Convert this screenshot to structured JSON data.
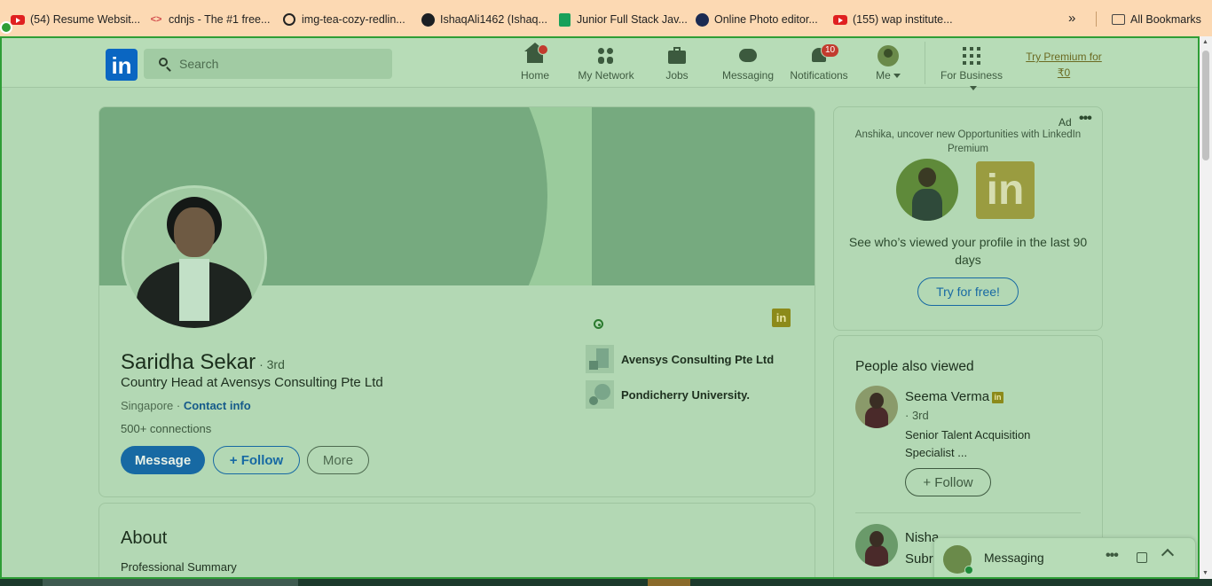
{
  "bookmarks": [
    {
      "label": "(54) Resume Websit...",
      "icon": "youtube-icon"
    },
    {
      "label": "cdnjs - The #1 free...",
      "icon": "code-icon"
    },
    {
      "label": "img-tea-cozy-redlin...",
      "icon": "globe-icon"
    },
    {
      "label": "IshaqAli1462 (Ishaq...",
      "icon": "github-icon"
    },
    {
      "label": "Junior Full Stack Jav...",
      "icon": "sheets-icon"
    },
    {
      "label": "Online Photo editor...",
      "icon": "photo-editor-icon"
    },
    {
      "label": "(155) wap institute...",
      "icon": "youtube-icon"
    }
  ],
  "bookmarks_overflow": "»",
  "all_bookmarks": "All Bookmarks",
  "nav": {
    "logo": "in",
    "search_placeholder": "Search",
    "items": [
      {
        "label": "Home",
        "icon": "home-icon",
        "badge": ""
      },
      {
        "label": "My Network",
        "icon": "network-icon",
        "badge": ""
      },
      {
        "label": "Jobs",
        "icon": "briefcase-icon",
        "badge": ""
      },
      {
        "label": "Messaging",
        "icon": "messaging-icon",
        "badge": ""
      },
      {
        "label": "Notifications",
        "icon": "bell-icon",
        "badge": "10"
      },
      {
        "label": "Me",
        "icon": "avatar-icon",
        "badge": ""
      }
    ],
    "business": "For Business",
    "premium_line1": "Try Premium for",
    "premium_line2": "₹0"
  },
  "profile": {
    "name": "Saridha Sekar",
    "degree": "· 3rd",
    "headline": "Country Head at Avensys Consulting Pte Ltd",
    "location": "Singapore ·",
    "contact": "Contact info",
    "connections": "500+ connections",
    "message_btn": "Message",
    "follow_btn": "Follow",
    "more_btn": "More",
    "experience": [
      {
        "name": "Avensys Consulting Pte Ltd"
      },
      {
        "name": "Pondicherry University."
      }
    ]
  },
  "about": {
    "title": "About",
    "subtitle": "Professional Summary"
  },
  "ad": {
    "label": "Ad",
    "more": "•••",
    "text": "Anshika, uncover new Opportunities with LinkedIn Premium",
    "logo": "in",
    "body": "See who’s viewed your profile in the last 90 days",
    "button": "Try for free!"
  },
  "people_also_viewed": {
    "title": "People also viewed",
    "people": [
      {
        "name": "Seema Verma",
        "degree": "· 3rd",
        "headline": "Senior Talent Acquisition Specialist ...",
        "follow": "Follow"
      },
      {
        "name": "Nisha Subr",
        "degree": "",
        "headline": "",
        "follow": ""
      }
    ]
  },
  "messaging": {
    "label": "Messaging",
    "more": "•••"
  }
}
